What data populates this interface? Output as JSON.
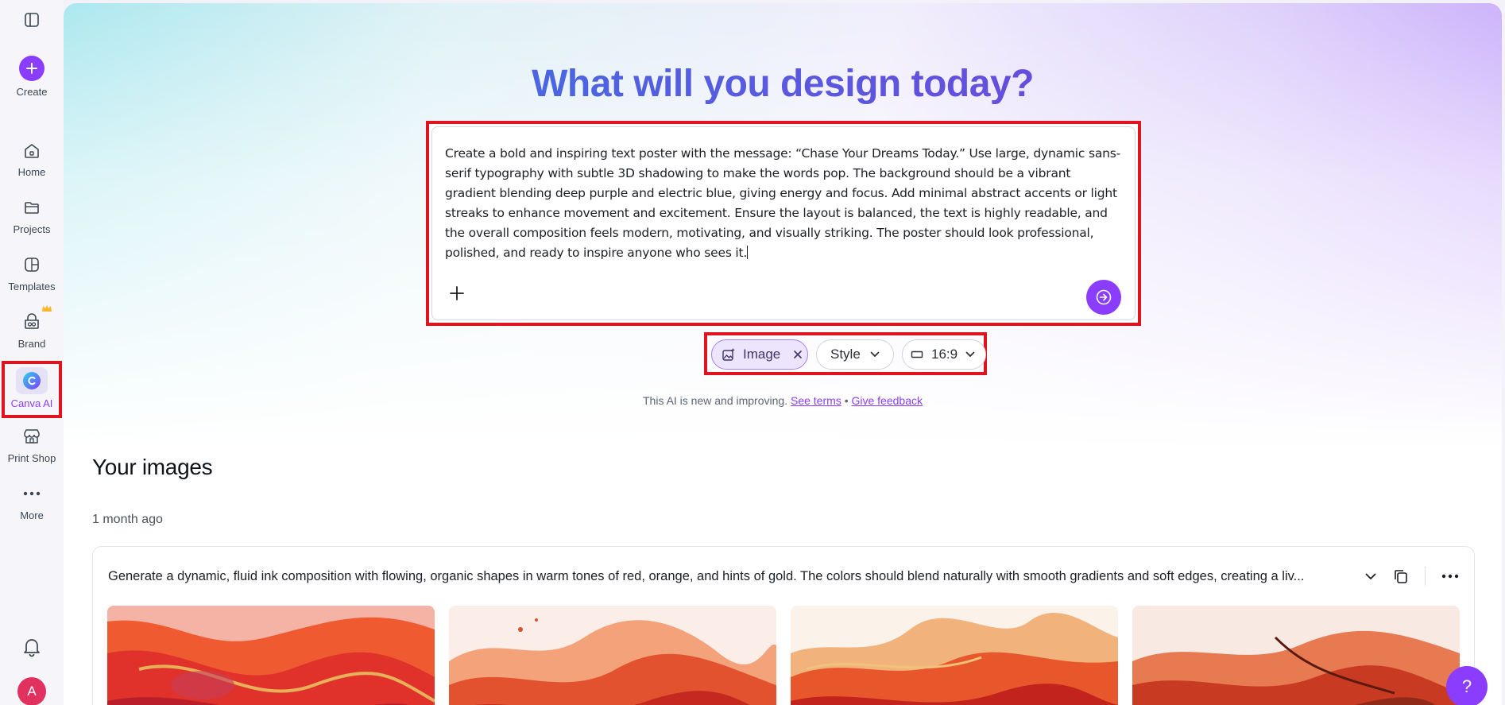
{
  "sidebar": {
    "create_label": "Create",
    "items": [
      {
        "label": "Home",
        "icon": "home-icon"
      },
      {
        "label": "Projects",
        "icon": "folder-icon"
      },
      {
        "label": "Templates",
        "icon": "templates-icon"
      },
      {
        "label": "Brand",
        "icon": "brand-icon"
      },
      {
        "label": "Canva AI",
        "icon": "canva-ai-icon"
      },
      {
        "label": "Print Shop",
        "icon": "print-shop-icon"
      },
      {
        "label": "More",
        "icon": "more-icon"
      }
    ],
    "avatar_initial": "A"
  },
  "hero": {
    "headline": "What will you design today?",
    "prompt": "Create a bold and inspiring text poster with the message: “Chase Your Dreams Today.” Use large, dynamic sans-serif typography with subtle 3D shadowing to make the words pop. The background should be a vibrant gradient blending deep purple and electric blue, giving energy and focus. Add minimal abstract accents or light streaks to enhance movement and excitement. Ensure the layout is balanced, the text is highly readable, and the overall composition feels modern, motivating, and visually striking. The poster should look professional, polished, and ready to inspire anyone who sees it.",
    "chips": {
      "image_label": "Image",
      "style_label": "Style",
      "ratio_label": "16:9"
    },
    "disclaimer": {
      "text": "This AI is new and improving.",
      "terms_link": "See terms",
      "separator": "•",
      "feedback_link": "Give feedback"
    }
  },
  "images_section": {
    "title": "Your images",
    "timestamp": "1 month ago",
    "card_prompt": "Generate a dynamic, fluid ink composition with flowing, organic shapes in warm tones of red, orange, and hints of gold. The colors should blend naturally with smooth gradients and soft edges, creating a liv..."
  },
  "help_label": "?",
  "colors": {
    "accent": "#8b3dff",
    "highlight_border": "#e0141e"
  }
}
